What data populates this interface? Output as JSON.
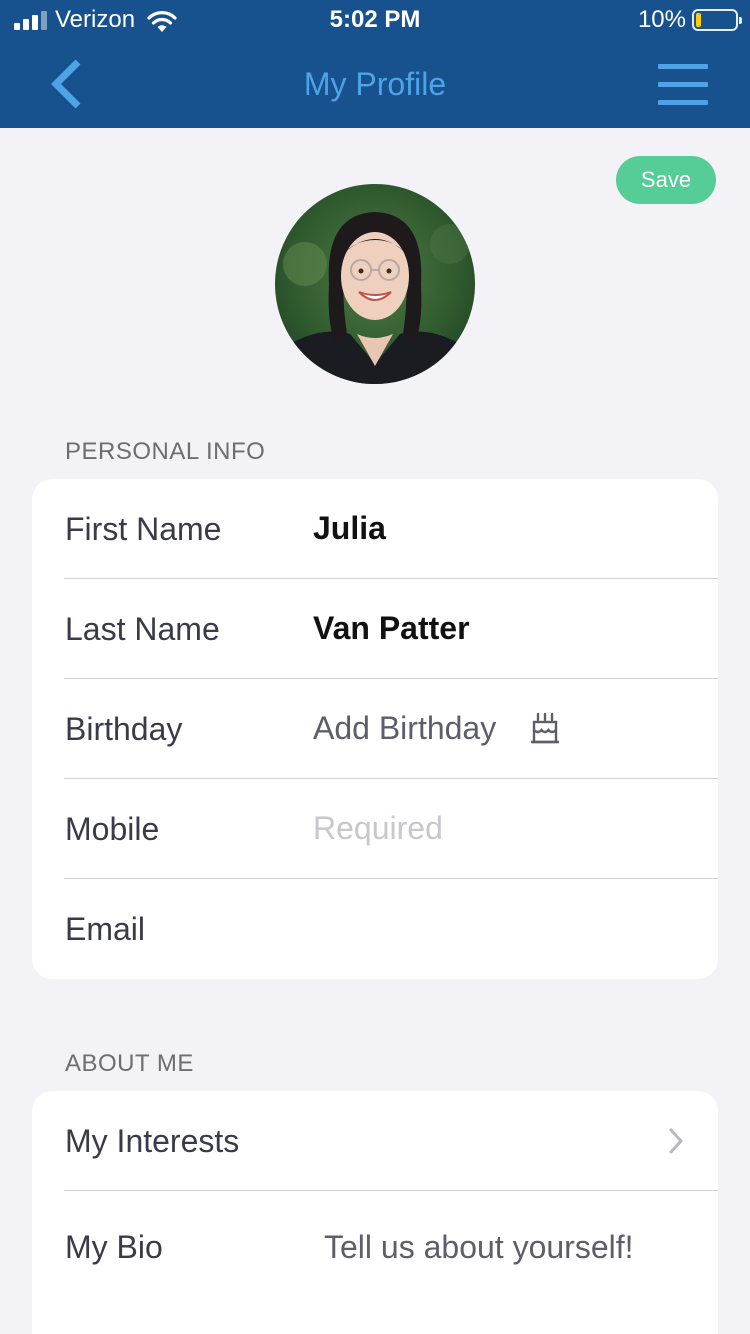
{
  "status_bar": {
    "carrier": "Verizon",
    "time": "5:02 PM",
    "battery_percent": "10%"
  },
  "nav": {
    "title": "My Profile",
    "back_icon": "chevron-left-icon",
    "menu_icon": "hamburger-menu-icon",
    "accent_color": "#4ea3e6",
    "header_color": "#17528f"
  },
  "save_button": {
    "label": "Save",
    "color": "#56cc96"
  },
  "personal_info": {
    "section_label": "PERSONAL INFO",
    "first_name": {
      "label": "First Name",
      "value": "Julia"
    },
    "last_name": {
      "label": "Last Name",
      "value": "Van Patter"
    },
    "birthday": {
      "label": "Birthday",
      "placeholder": "Add Birthday",
      "icon": "birthday-cake-icon"
    },
    "mobile": {
      "label": "Mobile",
      "placeholder": "Required"
    },
    "email": {
      "label": "Email",
      "value": ""
    }
  },
  "about_me": {
    "section_label": "ABOUT ME",
    "interests": {
      "label": "My Interests",
      "icon": "chevron-right-icon"
    },
    "bio": {
      "label": "My Bio",
      "placeholder": "Tell us about yourself!"
    }
  }
}
